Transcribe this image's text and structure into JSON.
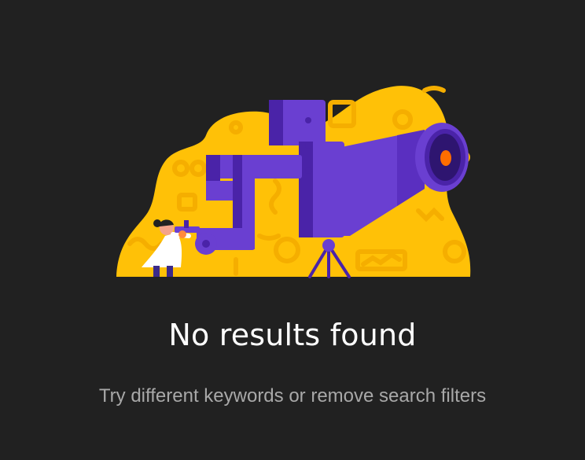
{
  "empty_state": {
    "title": "No results found",
    "subtitle": "Try different keywords or remove search filters"
  },
  "colors": {
    "background": "#212121",
    "blob": "#FFC107",
    "telescope": "#6A3FD1",
    "telescope_dark": "#4A23A8",
    "lens": "#FF6D00",
    "title_text": "#FFFFFF",
    "subtitle_text": "#A8A8A8"
  },
  "icons": {
    "illustration": "telescope-scientist-illustration"
  }
}
